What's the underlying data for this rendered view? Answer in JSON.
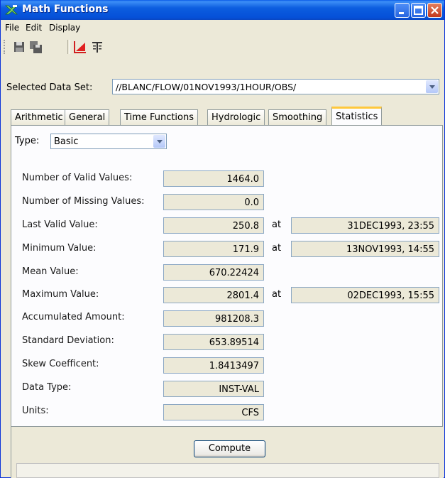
{
  "window": {
    "title": "Math Functions"
  },
  "menu": {
    "items": [
      {
        "label": "File"
      },
      {
        "label": "Edit"
      },
      {
        "label": "Display"
      }
    ]
  },
  "toolbar": {
    "icons": [
      "save-icon",
      "save-as-icon",
      "plot-icon",
      "table-icon"
    ]
  },
  "dataset": {
    "label": "Selected Data Set:",
    "value": "//BLANC/FLOW/01NOV1993/1HOUR/OBS/"
  },
  "tabs": [
    {
      "label": "Arithmetic"
    },
    {
      "label": "General"
    },
    {
      "label": "Time Functions"
    },
    {
      "label": "Hydrologic"
    },
    {
      "label": "Smoothing"
    },
    {
      "label": "Statistics",
      "active": true
    }
  ],
  "type": {
    "label": "Type:",
    "value": "Basic"
  },
  "stats": {
    "valid_count": {
      "label": "Number of Valid Values:",
      "value": "1464.0"
    },
    "missing_count": {
      "label": "Number of Missing Values:",
      "value": "0.0"
    },
    "last_valid": {
      "label": "Last Valid Value:",
      "value": "250.8",
      "at": "at",
      "date": "31DEC1993, 23:55"
    },
    "minimum": {
      "label": "Minimum Value:",
      "value": "171.9",
      "at": "at",
      "date": "13NOV1993, 14:55"
    },
    "mean": {
      "label": "Mean Value:",
      "value": "670.22424"
    },
    "maximum": {
      "label": "Maximum Value:",
      "value": "2801.4",
      "at": "at",
      "date": "02DEC1993, 15:55"
    },
    "accumulated": {
      "label": "Accumulated Amount:",
      "value": "981208.3"
    },
    "std_dev": {
      "label": "Standard Deviation:",
      "value": "653.89514"
    },
    "skew": {
      "label": "Skew Coefficent:",
      "value": "1.8413497"
    },
    "data_type": {
      "label": "Data Type:",
      "value": "INST-VAL"
    },
    "units": {
      "label": "Units:",
      "value": "CFS"
    }
  },
  "compute": {
    "label": "Compute"
  },
  "colors": {
    "titlebar": "#0a5ae8",
    "background": "#ece9d8",
    "active_tab_accent": "#ffc83c"
  }
}
